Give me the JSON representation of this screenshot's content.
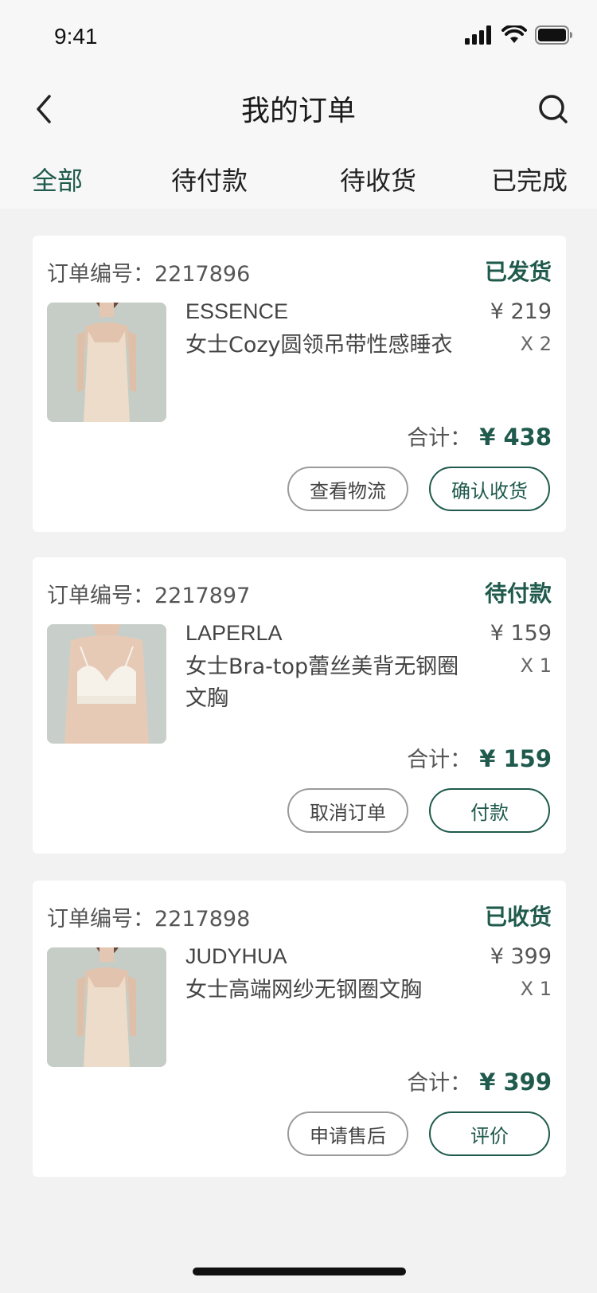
{
  "status_bar": {
    "time": "9:41",
    "icons": [
      "signal-icon",
      "wifi-icon",
      "battery-icon"
    ]
  },
  "header": {
    "title": "我的订单",
    "back_icon": "chevron-left-icon",
    "search_icon": "search-icon"
  },
  "tabs": [
    {
      "label": "全部",
      "active": true
    },
    {
      "label": "待付款",
      "active": false
    },
    {
      "label": "待收货",
      "active": false
    },
    {
      "label": "已完成",
      "active": false
    }
  ],
  "orders": [
    {
      "order_no": "订单编号：2217896",
      "status": "已发货",
      "brand": "ESSENCE",
      "product_name": "女士Cozy圆领吊带性感睡衣",
      "price": "¥ 219",
      "quantity": "X 2",
      "total_label": "合计：",
      "total_value": "¥ 438",
      "secondary_action": "查看物流",
      "primary_action": "确认收货",
      "image": "slip-dress-photo"
    },
    {
      "order_no": "订单编号：2217897",
      "status": "待付款",
      "brand": "LAPERLA",
      "product_name": "女士Bra-top蕾丝美背无钢圈文胸",
      "price": "¥ 159",
      "quantity": "X 1",
      "total_label": "合计：",
      "total_value": "¥ 159",
      "secondary_action": "取消订单",
      "primary_action": "付款",
      "image": "bralette-photo"
    },
    {
      "order_no": "订单编号：2217898",
      "status": "已收货",
      "brand": "JUDYHUA",
      "product_name": "女士高端网纱无钢圈文胸",
      "price": "¥ 399",
      "quantity": "X 1",
      "total_label": "合计：",
      "total_value": "¥ 399",
      "secondary_action": "申请售后",
      "primary_action": "评价",
      "image": "slip-dress-photo"
    }
  ],
  "colors": {
    "accent": "#1f5a4c",
    "background": "#f2f2f2",
    "card": "#ffffff"
  }
}
